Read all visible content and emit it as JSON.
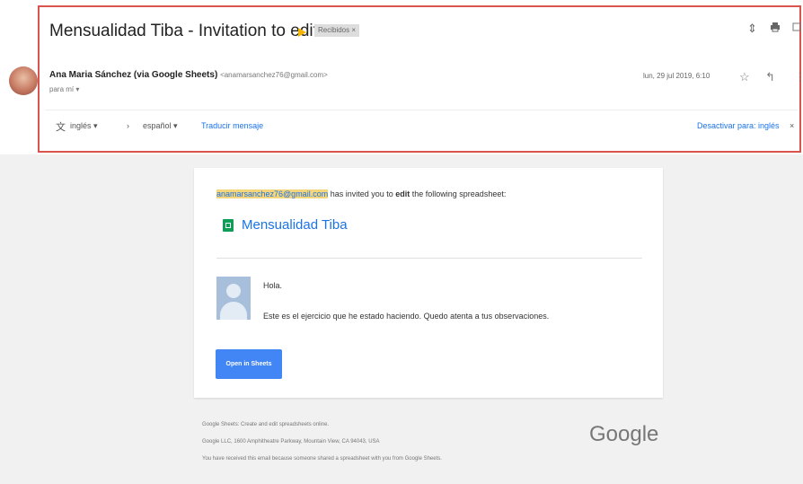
{
  "email": {
    "subject": "Mensualidad Tiba - Invitation to edit",
    "label_chip": "Recibidos ×",
    "sender_name": "Ana Maria Sánchez (via Google Sheets)",
    "sender_email": "<anamarsanchez76@gmail.com>",
    "to": "para mí ▾",
    "date": "lun, 29 jul 2019, 6:10",
    "icons": {
      "expand": "expand-icon",
      "print": "print-icon",
      "open_new": "open-in-new-icon",
      "star": "star-icon",
      "reply": "reply-icon",
      "more": "more-icon"
    }
  },
  "translate": {
    "from_lang": "inglés ▾",
    "arrow": "›",
    "to_lang": "español ▾",
    "translate_link": "Traducir mensaje",
    "disable_link": "Desactivar para: inglés",
    "close": "×"
  },
  "card": {
    "inviter_email": "anamarsanchez76@gmail.com",
    "invite_text_1": " has invited you to ",
    "invite_bold": "edit",
    "invite_text_2": " the following spreadsheet:",
    "doc_title": "Mensualidad Tiba",
    "message_greeting": "Hola.",
    "message_body": "Este es el ejercicio que he estado haciendo. Quedo atenta a tus observaciones.",
    "open_button": "Open in Sheets"
  },
  "footer": {
    "line1": "Google Sheets: Create and edit spreadsheets online.",
    "line2": "Google LLC, 1600 Amphitheatre Parkway, Mountain View, CA 94043, USA",
    "line3": "You have received this email because someone shared a spreadsheet with you from Google Sheets.",
    "logo": "Google"
  },
  "colors": {
    "highlight_border": "#d9534f",
    "link": "#1a73e8",
    "button": "#4285f4",
    "sheets_green": "#0f9d58"
  }
}
